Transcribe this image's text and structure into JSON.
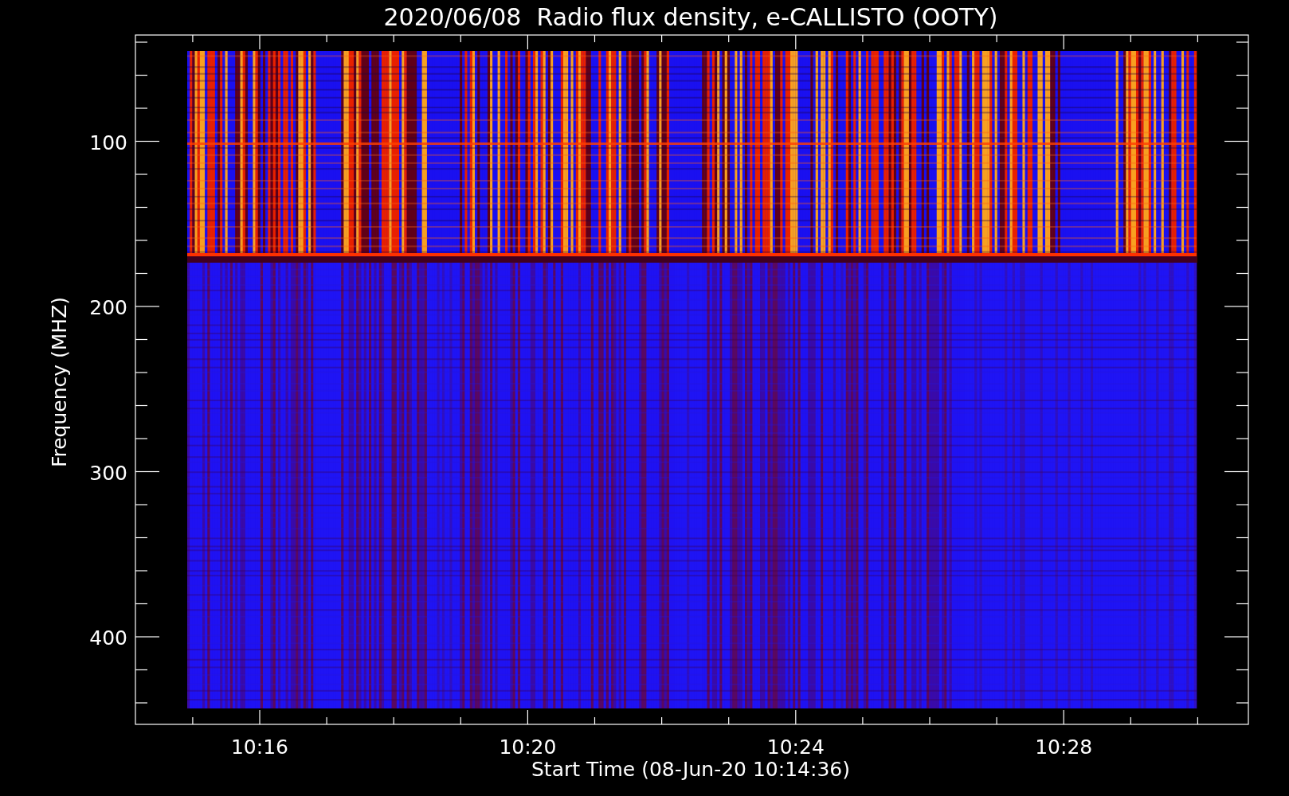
{
  "title": "2020/06/08  Radio flux density, e-CALLISTO (OOTY)",
  "plot": {
    "xlabel": "Start Time (08-Jun-20 10:14:36)",
    "ylabel": "Frequency (MHZ)",
    "xticks": [
      {
        "label": "10:16"
      },
      {
        "label": "10:20"
      },
      {
        "label": "10:24"
      },
      {
        "label": "10:28"
      }
    ],
    "yticks": [
      {
        "label": "100"
      },
      {
        "label": "200"
      },
      {
        "label": "300"
      },
      {
        "label": "400"
      }
    ]
  }
}
